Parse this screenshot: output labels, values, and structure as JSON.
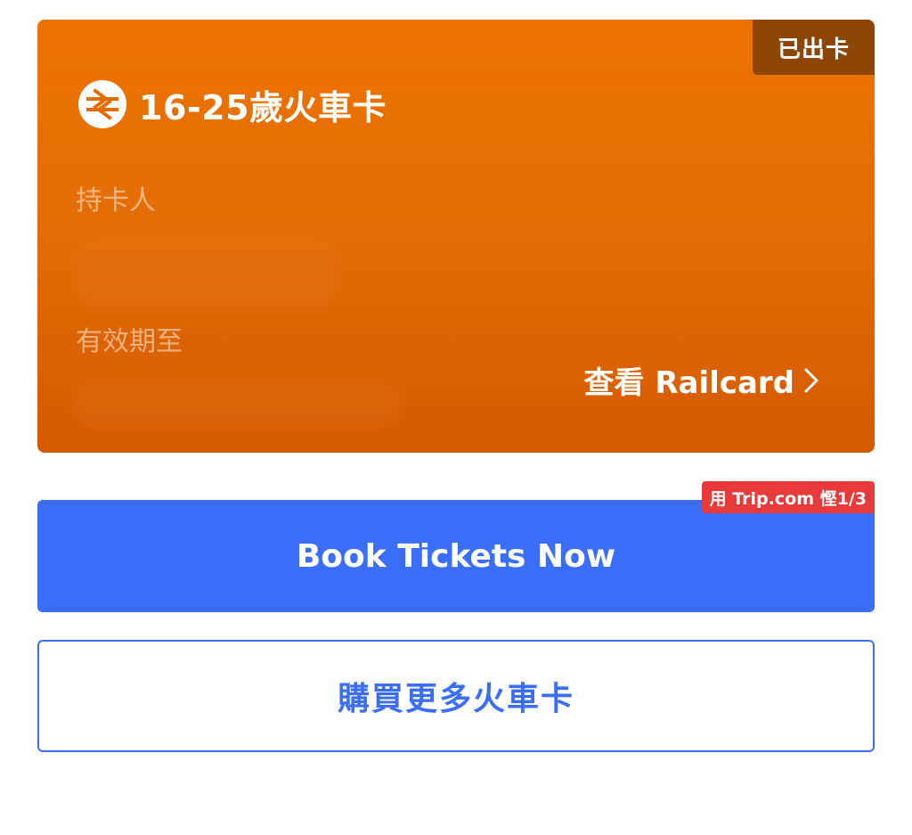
{
  "railcard": {
    "status_badge": "已出卡",
    "icon": "national-rail-icon",
    "title": "16-25歲火車卡",
    "holder_label": "持卡人",
    "valid_until_label": "有效期至",
    "view_link_label": "查看 Railcard",
    "view_link_icon": "chevron-right-icon",
    "colors": {
      "card_top": "#ec7300",
      "card_bottom": "#d55a00",
      "badge_bg": "#8e4606"
    }
  },
  "actions": {
    "promo_badge": "用 Trip.com 慳1/3",
    "book_label": "Book Tickets Now",
    "buy_more_label": "購買更多火車卡",
    "colors": {
      "primary": "#3b6ef8",
      "promo": "#e83a3a"
    }
  }
}
